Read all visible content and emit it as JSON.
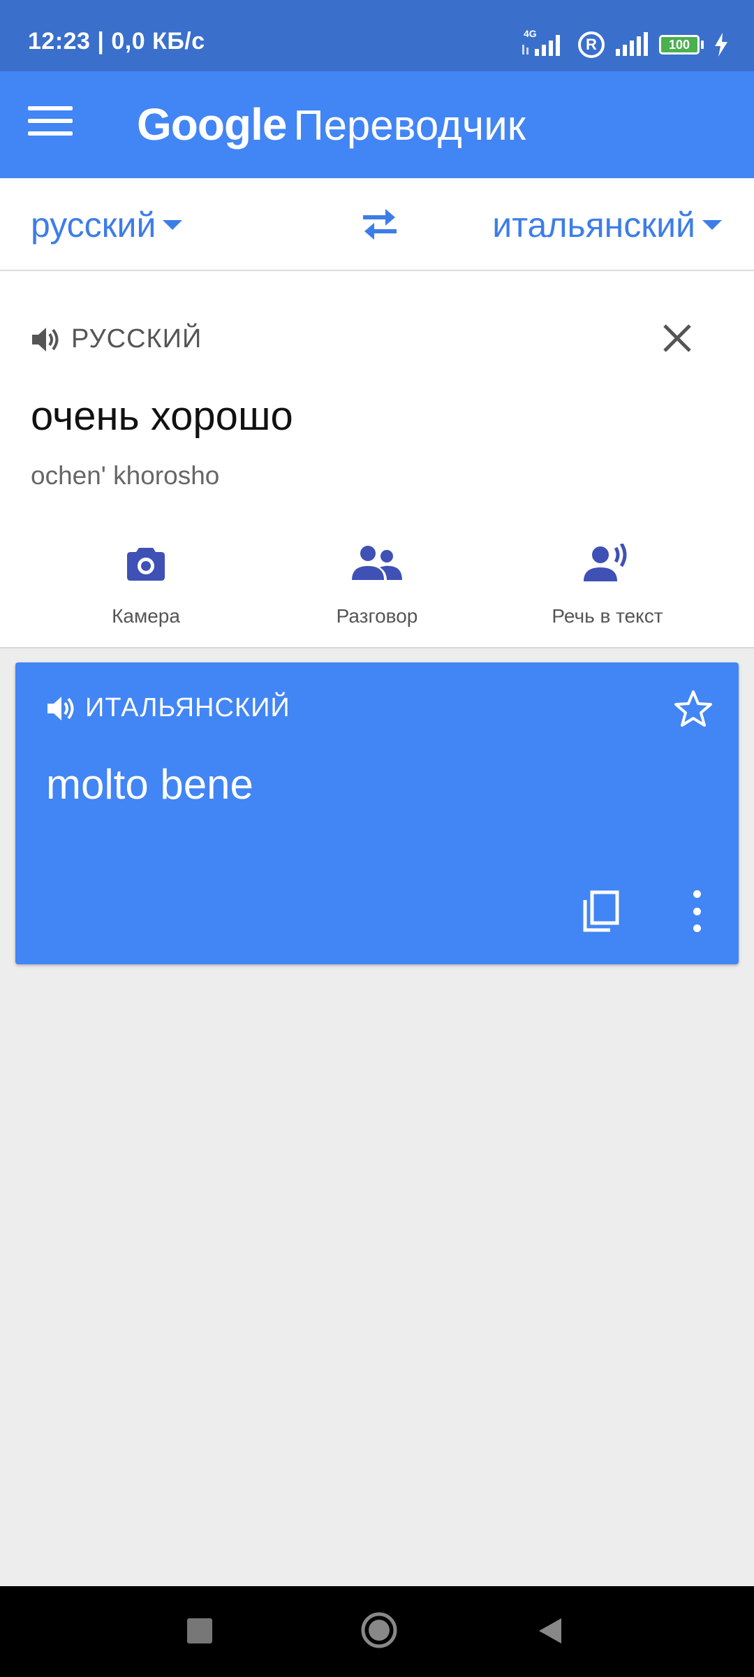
{
  "status_bar": {
    "time_speed": "12:23 | 0,0 КБ/с",
    "network": "4G",
    "roaming": "R",
    "battery": "100"
  },
  "app_bar": {
    "brand": "Google",
    "product": "Переводчик"
  },
  "languages": {
    "source": "русский",
    "target": "итальянский"
  },
  "source": {
    "lang_label": "РУССКИЙ",
    "text": "очень хорошо",
    "transliteration": "ochen' khorosho"
  },
  "actions": [
    {
      "label": "Камера",
      "icon": "camera-icon"
    },
    {
      "label": "Разговор",
      "icon": "conversation-icon"
    },
    {
      "label": "Речь в текст",
      "icon": "speech-to-text-icon"
    }
  ],
  "translation": {
    "lang_label": "ИТАЛЬЯНСКИЙ",
    "text": "molto bene"
  },
  "colors": {
    "primary": "#4285f4",
    "status": "#3a6fcc",
    "accent_text": "#3d7de8",
    "icon_indigo": "#3f51b5"
  }
}
